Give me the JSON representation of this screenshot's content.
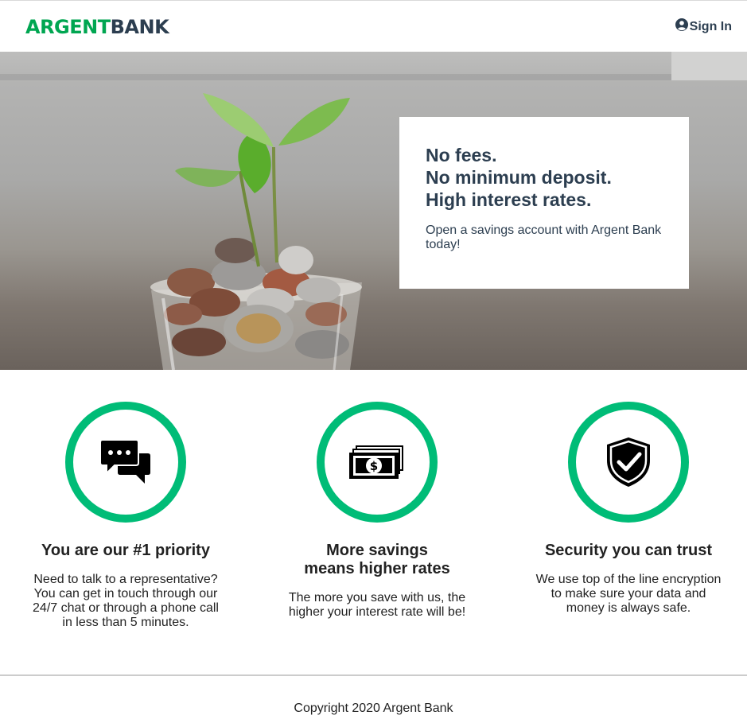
{
  "colors": {
    "brand_green": "#00a651",
    "brand_dark": "#2c3e50",
    "ring_green": "#00bc77"
  },
  "header": {
    "logo_part1": "ARGENT",
    "logo_part2": "BANK",
    "signin_icon": "user-circle-icon",
    "signin_label": "Sign In"
  },
  "hero": {
    "image": "plant-sprouting-from-jar-of-coins",
    "headline_lines": [
      "No fees.",
      "No minimum deposit.",
      "High interest rates."
    ],
    "subtitle": "Open a savings account with Argent Bank today!"
  },
  "features": [
    {
      "icon": "chat-bubbles-icon",
      "title": "You are our #1 priority",
      "description": "Need to talk to a representative? You can get in touch through our 24/7 chat or through a phone call in less than 5 minutes."
    },
    {
      "icon": "money-bills-icon",
      "title": "More savings means higher rates",
      "description": "The more you save with us, the higher your interest rate will be!"
    },
    {
      "icon": "shield-check-icon",
      "title": "Security you can trust",
      "description": "We use top of the line encryption to make sure your data and money is always safe."
    }
  ],
  "footer": {
    "copyright": "Copyright 2020 Argent Bank"
  }
}
